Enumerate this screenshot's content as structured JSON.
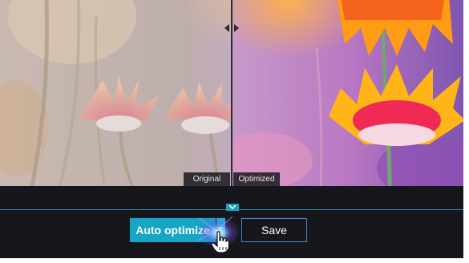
{
  "compare": {
    "original_label": "Original",
    "optimized_label": "Optimized"
  },
  "actions": {
    "auto_optimize_label": "Auto optimize",
    "save_label": "Save"
  },
  "icons": {
    "split_handle": "split-handle-icon",
    "collapse": "chevron-down-icon",
    "dropdown": "caret-down-icon",
    "cursor": "hand-pointer-icon"
  },
  "colors": {
    "accent": "#14a6c4",
    "save_border": "#4b87c9",
    "panel_bg": "#15171c"
  }
}
